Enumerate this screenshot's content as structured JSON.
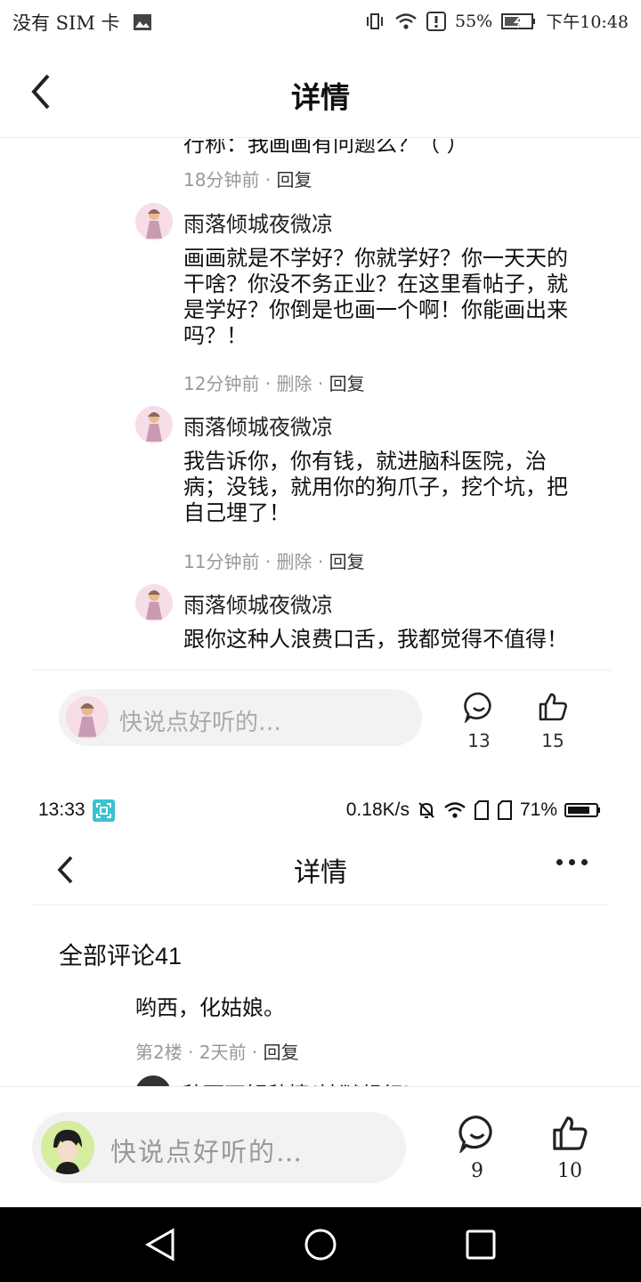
{
  "top": {
    "status_bar": {
      "carrier": "没有 SIM 卡",
      "battery_pct": "55%",
      "time": "下午10:48"
    },
    "header": {
      "title": "详情"
    },
    "partial_text": "行称：我画画有问题么？（ ）",
    "first_meta": {
      "time": "18分钟前",
      "reply": "回复"
    },
    "comments": [
      {
        "name": "雨落倾城夜微凉",
        "text": "画画就是不学好？你就学好？你一天天的干啥？你没不务正业？在这里看帖子，就是学好？你倒是也画一个啊！你能画出来吗？！",
        "time": "12分钟前",
        "delete": "删除",
        "reply": "回复"
      },
      {
        "name": "雨落倾城夜微凉",
        "text": "我告诉你，你有钱，就进脑科医院，治病；没钱，就用你的狗爪子，挖个坑，把自己埋了！",
        "time": "11分钟前",
        "delete": "删除",
        "reply": "回复"
      },
      {
        "name": "雨落倾城夜微凉",
        "text": "跟你这种人浪费口舌，我都觉得不值得！"
      }
    ],
    "bottom_bar": {
      "placeholder": "快说点好听的…",
      "comment_count": "13",
      "like_count": "15"
    }
  },
  "bottom": {
    "status_bar": {
      "time": "13:33",
      "speed": "0.18K/s",
      "battery_pct": "71%"
    },
    "header": {
      "title": "详情"
    },
    "section_title": "全部评论41",
    "comment": {
      "text": "哟西，化姑娘。",
      "floor": "第2楼",
      "time": "2天前",
      "reply": "回复"
    },
    "partial_name": "秋雨不解秋情(地狱组织)",
    "bottom_bar": {
      "placeholder": "快说点好听的…",
      "comment_count": "9",
      "like_count": "10"
    }
  },
  "icons": [
    "back-icon",
    "comment-icon",
    "thumbs-up-icon",
    "wifi-icon",
    "battery-icon",
    "more-icon",
    "nav-back-icon",
    "nav-home-icon",
    "nav-recents-icon"
  ]
}
